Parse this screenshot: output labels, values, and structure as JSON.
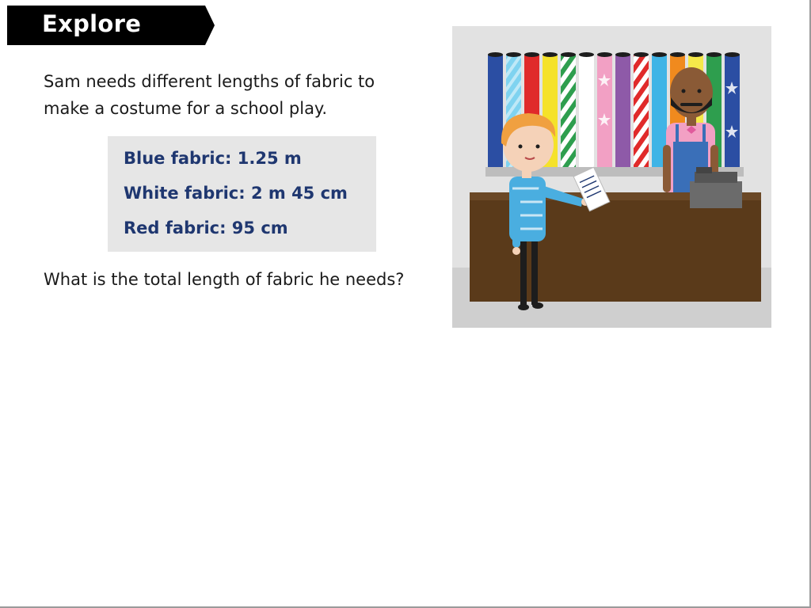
{
  "banner": {
    "label": "Explore"
  },
  "intro": {
    "line1": "Sam needs different lengths of fabric to",
    "line2": "make a costume for a school play."
  },
  "fabrics": [
    {
      "label": "Blue fabric: 1.25 m"
    },
    {
      "label": "White fabric: 2 m 45 cm"
    },
    {
      "label": "Red fabric: 95 cm"
    }
  ],
  "question": "What is the total length of fabric he needs?",
  "colors": {
    "banner_bg": "#000000",
    "banner_text": "#ffffff",
    "fabric_text": "#1f3770",
    "fabric_box_bg": "#e6e6e6",
    "body_text": "#1a1a1a"
  },
  "illustration": {
    "subject": "fabric-shop-scene",
    "icons": [
      "fabric-rolls",
      "boy-with-list",
      "shopkeeper",
      "shop-counter",
      "cash-register"
    ]
  }
}
